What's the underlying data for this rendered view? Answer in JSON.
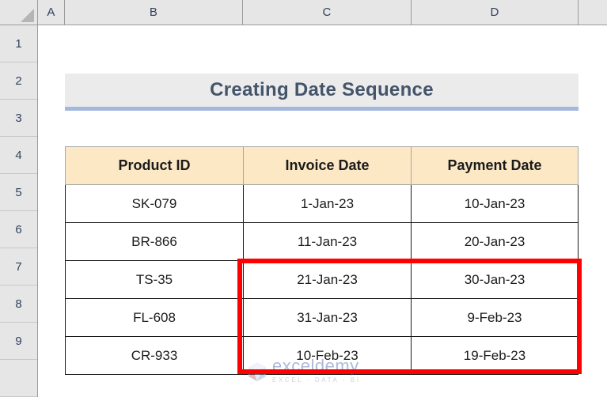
{
  "app": {
    "type": "spreadsheet",
    "columns": [
      "A",
      "B",
      "C",
      "D"
    ],
    "rows": [
      "1",
      "2",
      "3",
      "4",
      "5",
      "6",
      "7",
      "8",
      "9"
    ]
  },
  "colors": {
    "header_fill": "#FCE8C4",
    "title_fill": "#EBEBEB",
    "title_text": "#44546A",
    "title_underline": "#A3B8DE",
    "grid_header": "#E6E6E6",
    "cell_border": "#1B1B1B",
    "highlight": "#FF0000",
    "cell_text": "#1B1B1B"
  },
  "title": {
    "text": "Creating Date Sequence",
    "merged_range": "B2:D2"
  },
  "table": {
    "header_row": "4",
    "headers": [
      "Product ID",
      "Invoice Date",
      "Payment Date"
    ],
    "rows": [
      {
        "row": "5",
        "product_id": "SK-079",
        "invoice_date": "1-Jan-23",
        "payment_date": "10-Jan-23"
      },
      {
        "row": "6",
        "product_id": "BR-866",
        "invoice_date": "11-Jan-23",
        "payment_date": "20-Jan-23"
      },
      {
        "row": "7",
        "product_id": "TS-35",
        "invoice_date": "21-Jan-23",
        "payment_date": "30-Jan-23"
      },
      {
        "row": "8",
        "product_id": "FL-608",
        "invoice_date": "31-Jan-23",
        "payment_date": "9-Feb-23"
      },
      {
        "row": "9",
        "product_id": "CR-933",
        "invoice_date": "10-Feb-23",
        "payment_date": "19-Feb-23"
      }
    ]
  },
  "highlight": {
    "shape": "rectangle",
    "color": "#FF0000",
    "covers_range": "C7:D9"
  },
  "watermark": {
    "name": "exceldemy",
    "tagline": "EXCEL - DATA - BI"
  }
}
